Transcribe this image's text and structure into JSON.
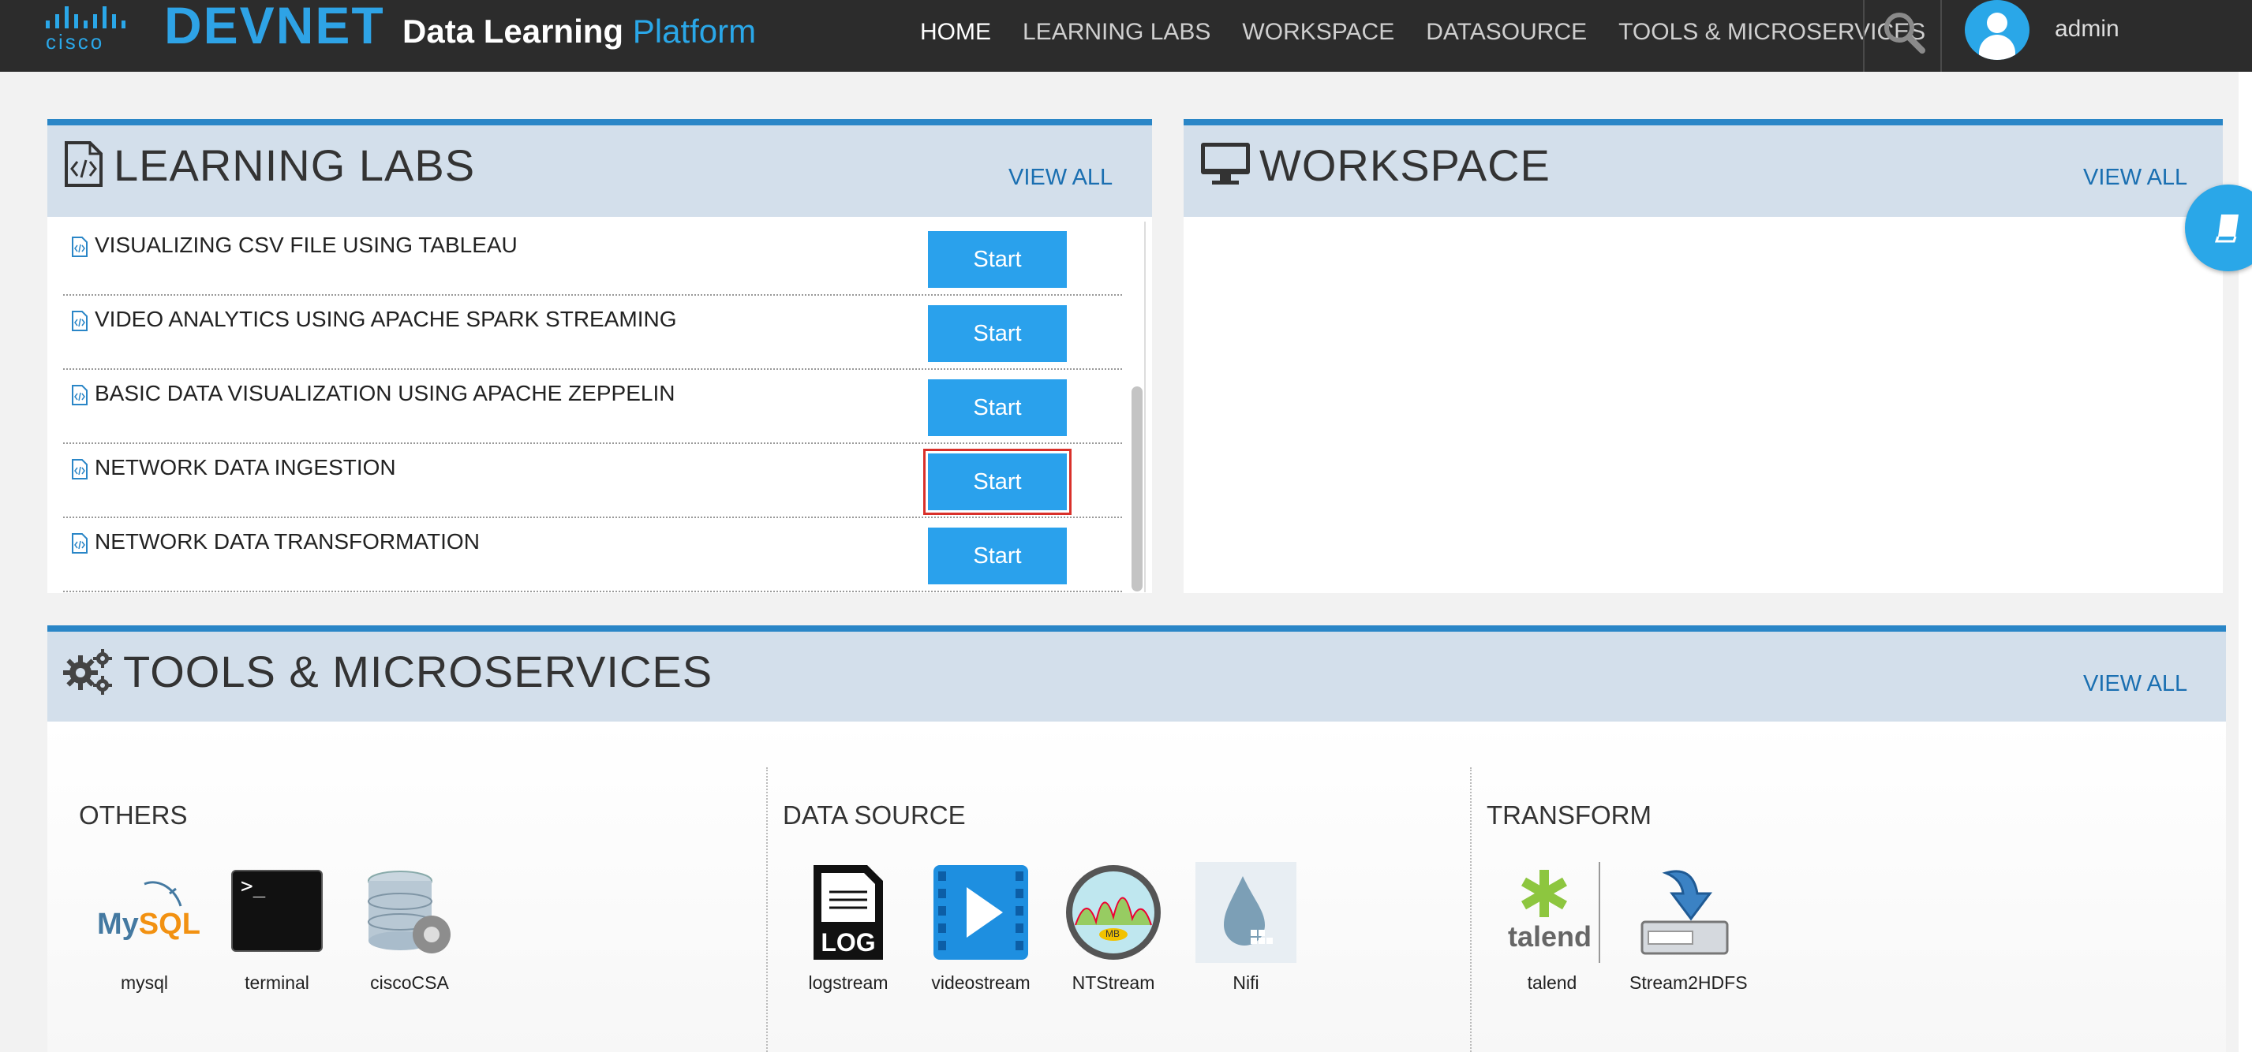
{
  "header": {
    "brand_cisco": "cisco",
    "brand_devnet": "DEVNET",
    "platform_title_bold": "Data Learning",
    "platform_title_light": "Platform",
    "nav": [
      {
        "label": "HOME",
        "active": true
      },
      {
        "label": "LEARNING LABS",
        "active": false
      },
      {
        "label": "WORKSPACE",
        "active": false
      },
      {
        "label": "DATASOURCE",
        "active": false
      },
      {
        "label": "TOOLS & MICROSERVICES",
        "active": false
      }
    ],
    "user": "admin"
  },
  "learning_labs": {
    "title": "LEARNING LABS",
    "view_all": "VIEW ALL",
    "items": [
      {
        "label": "VISUALIZING CSV FILE USING TABLEAU",
        "button": "Start"
      },
      {
        "label": "VIDEO ANALYTICS USING APACHE SPARK STREAMING",
        "button": "Start"
      },
      {
        "label": "BASIC DATA VISUALIZATION USING APACHE ZEPPELIN",
        "button": "Start"
      },
      {
        "label": "NETWORK DATA INGESTION",
        "button": "Start",
        "selected": true
      },
      {
        "label": "NETWORK DATA TRANSFORMATION",
        "button": "Start"
      }
    ]
  },
  "workspace": {
    "title": "WORKSPACE",
    "view_all": "VIEW ALL"
  },
  "tools": {
    "title": "TOOLS & MICROSERVICES",
    "view_all": "VIEW ALL",
    "sections": [
      {
        "title": "OTHERS",
        "items": [
          "mysql",
          "terminal",
          "ciscoCSA"
        ]
      },
      {
        "title": "DATA SOURCE",
        "items": [
          "logstream",
          "videostream",
          "NTStream",
          "Nifi"
        ]
      },
      {
        "title": "TRANSFORM",
        "items": [
          "talend",
          "Stream2HDFS"
        ]
      }
    ],
    "icon_text": {
      "mysql_my": "My",
      "mysql_sql": "SQL",
      "terminal_prompt": ">_",
      "log_label": "LOG",
      "ntstream_badge": "MB",
      "talend_word": "talend"
    }
  },
  "colors": {
    "accent": "#2aa1ec",
    "header_bg": "#2c2c2c",
    "panel_head_bg": "#d3dfeb",
    "panel_border": "#2a86c7",
    "selected_outline": "#d9302a"
  }
}
